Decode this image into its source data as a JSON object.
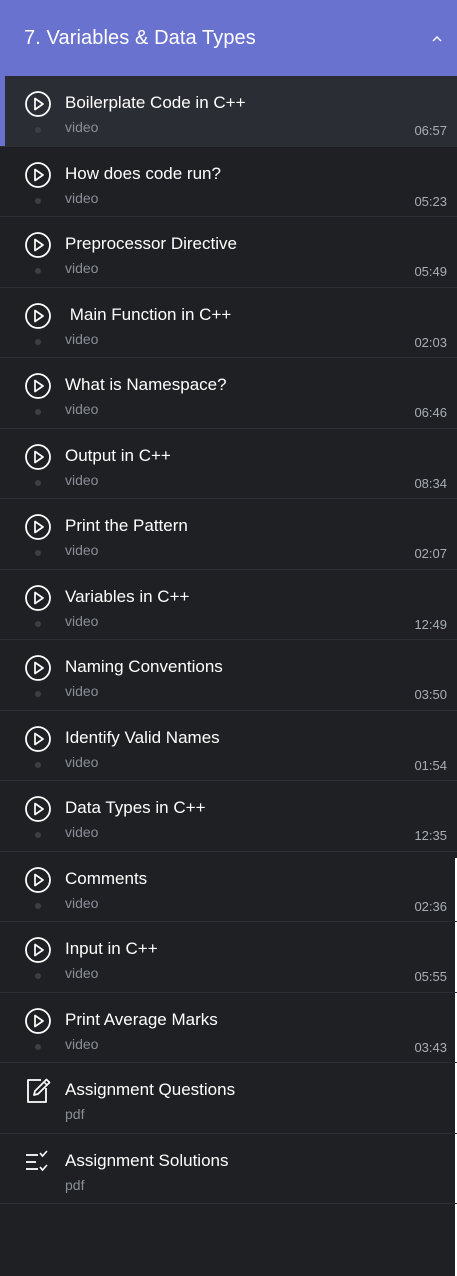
{
  "section": {
    "title": "7. Variables & Data Types",
    "toggle_icon": "chevron-up-icon",
    "accent_color": "#6a72cf"
  },
  "lessons": [
    {
      "title": "Boilerplate Code in C++",
      "type": "video",
      "duration": "06:57",
      "icon": "play-circle-icon",
      "active": true
    },
    {
      "title": "How does code run?",
      "type": "video",
      "duration": "05:23",
      "icon": "play-circle-icon"
    },
    {
      "title": "Preprocessor Directive",
      "type": "video",
      "duration": "05:49",
      "icon": "play-circle-icon"
    },
    {
      "title": " Main Function in C++",
      "type": "video",
      "duration": "02:03",
      "icon": "play-circle-icon"
    },
    {
      "title": "What is Namespace?",
      "type": "video",
      "duration": "06:46",
      "icon": "play-circle-icon"
    },
    {
      "title": "Output in C++",
      "type": "video",
      "duration": "08:34",
      "icon": "play-circle-icon"
    },
    {
      "title": "Print the Pattern",
      "type": "video",
      "duration": "02:07",
      "icon": "play-circle-icon"
    },
    {
      "title": "Variables in C++",
      "type": "video",
      "duration": "12:49",
      "icon": "play-circle-icon"
    },
    {
      "title": "Naming Conventions",
      "type": "video",
      "duration": "03:50",
      "icon": "play-circle-icon"
    },
    {
      "title": "Identify Valid Names",
      "type": "video",
      "duration": "01:54",
      "icon": "play-circle-icon"
    },
    {
      "title": "Data Types in C++",
      "type": "video",
      "duration": "12:35",
      "icon": "play-circle-icon"
    },
    {
      "title": "Comments",
      "type": "video",
      "duration": "02:36",
      "icon": "play-circle-icon"
    },
    {
      "title": "Input in C++",
      "type": "video",
      "duration": "05:55",
      "icon": "play-circle-icon"
    },
    {
      "title": "Print Average Marks",
      "type": "video",
      "duration": "03:43",
      "icon": "play-circle-icon"
    },
    {
      "title": "Assignment Questions",
      "type": "pdf",
      "duration": "",
      "icon": "edit-document-icon"
    },
    {
      "title": "Assignment Solutions",
      "type": "pdf",
      "duration": "",
      "icon": "checklist-icon"
    }
  ]
}
